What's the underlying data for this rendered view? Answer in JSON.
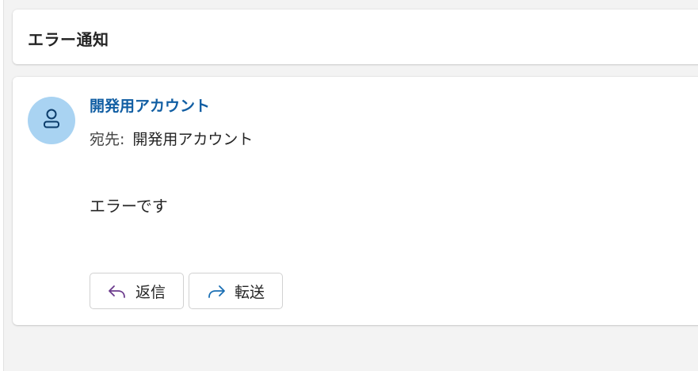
{
  "message": {
    "subject": "エラー通知",
    "sender_name": "開発用アカウント",
    "to_label": "宛先:",
    "to_name": "開発用アカウント",
    "body": "エラーです",
    "avatar_icon": "person-icon"
  },
  "actions": {
    "reply_label": "返信",
    "reply_icon": "reply-arrow-icon",
    "forward_label": "転送",
    "forward_icon": "forward-arrow-icon"
  },
  "colors": {
    "sender": "#115ea3",
    "avatar_bg": "#a9d3f2",
    "reply_icon": "#6b3a8c",
    "forward_icon": "#1a6fb4"
  }
}
